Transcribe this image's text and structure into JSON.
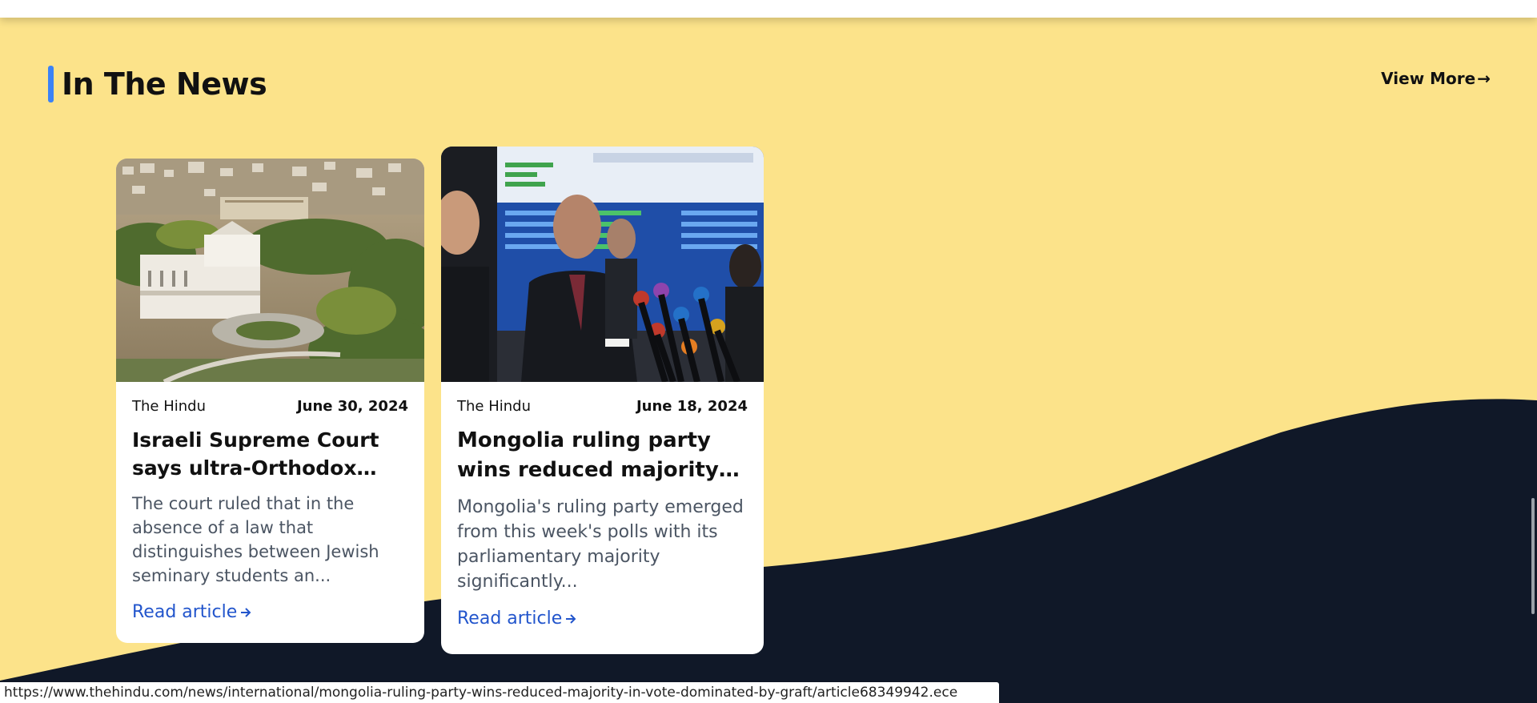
{
  "section": {
    "title": "In The News",
    "view_more_label": "View More",
    "view_more_arrow": "→"
  },
  "articles": [
    {
      "source": "The Hindu",
      "date": "June 30, 2024",
      "headline": "Israeli Supreme Court says ultra-Orthodox must serve in military",
      "excerpt": "The court ruled that in the absence of a law that distinguishes between Jewish seminary students an...",
      "read_label": "Read article",
      "image_icon": "supreme-court-building-photo"
    },
    {
      "source": "The Hindu",
      "date": "June 18, 2024",
      "headline": "Mongolia ruling party wins reduced majority in vote dominated by graft",
      "excerpt": "Mongolia's ruling party emerged from this week's polls with its parliamentary majority significantly...",
      "read_label": "Read article",
      "image_icon": "press-conference-photo"
    }
  ],
  "status_bar": {
    "url": "https://www.thehindu.com/news/international/mongolia-ruling-party-wins-reduced-majority-in-vote-dominated-by-graft/article68349942.ece"
  },
  "colors": {
    "section_bg": "#fce38a",
    "wave_bg": "#101828",
    "accent": "#3b82f6",
    "link": "#2255cc"
  }
}
